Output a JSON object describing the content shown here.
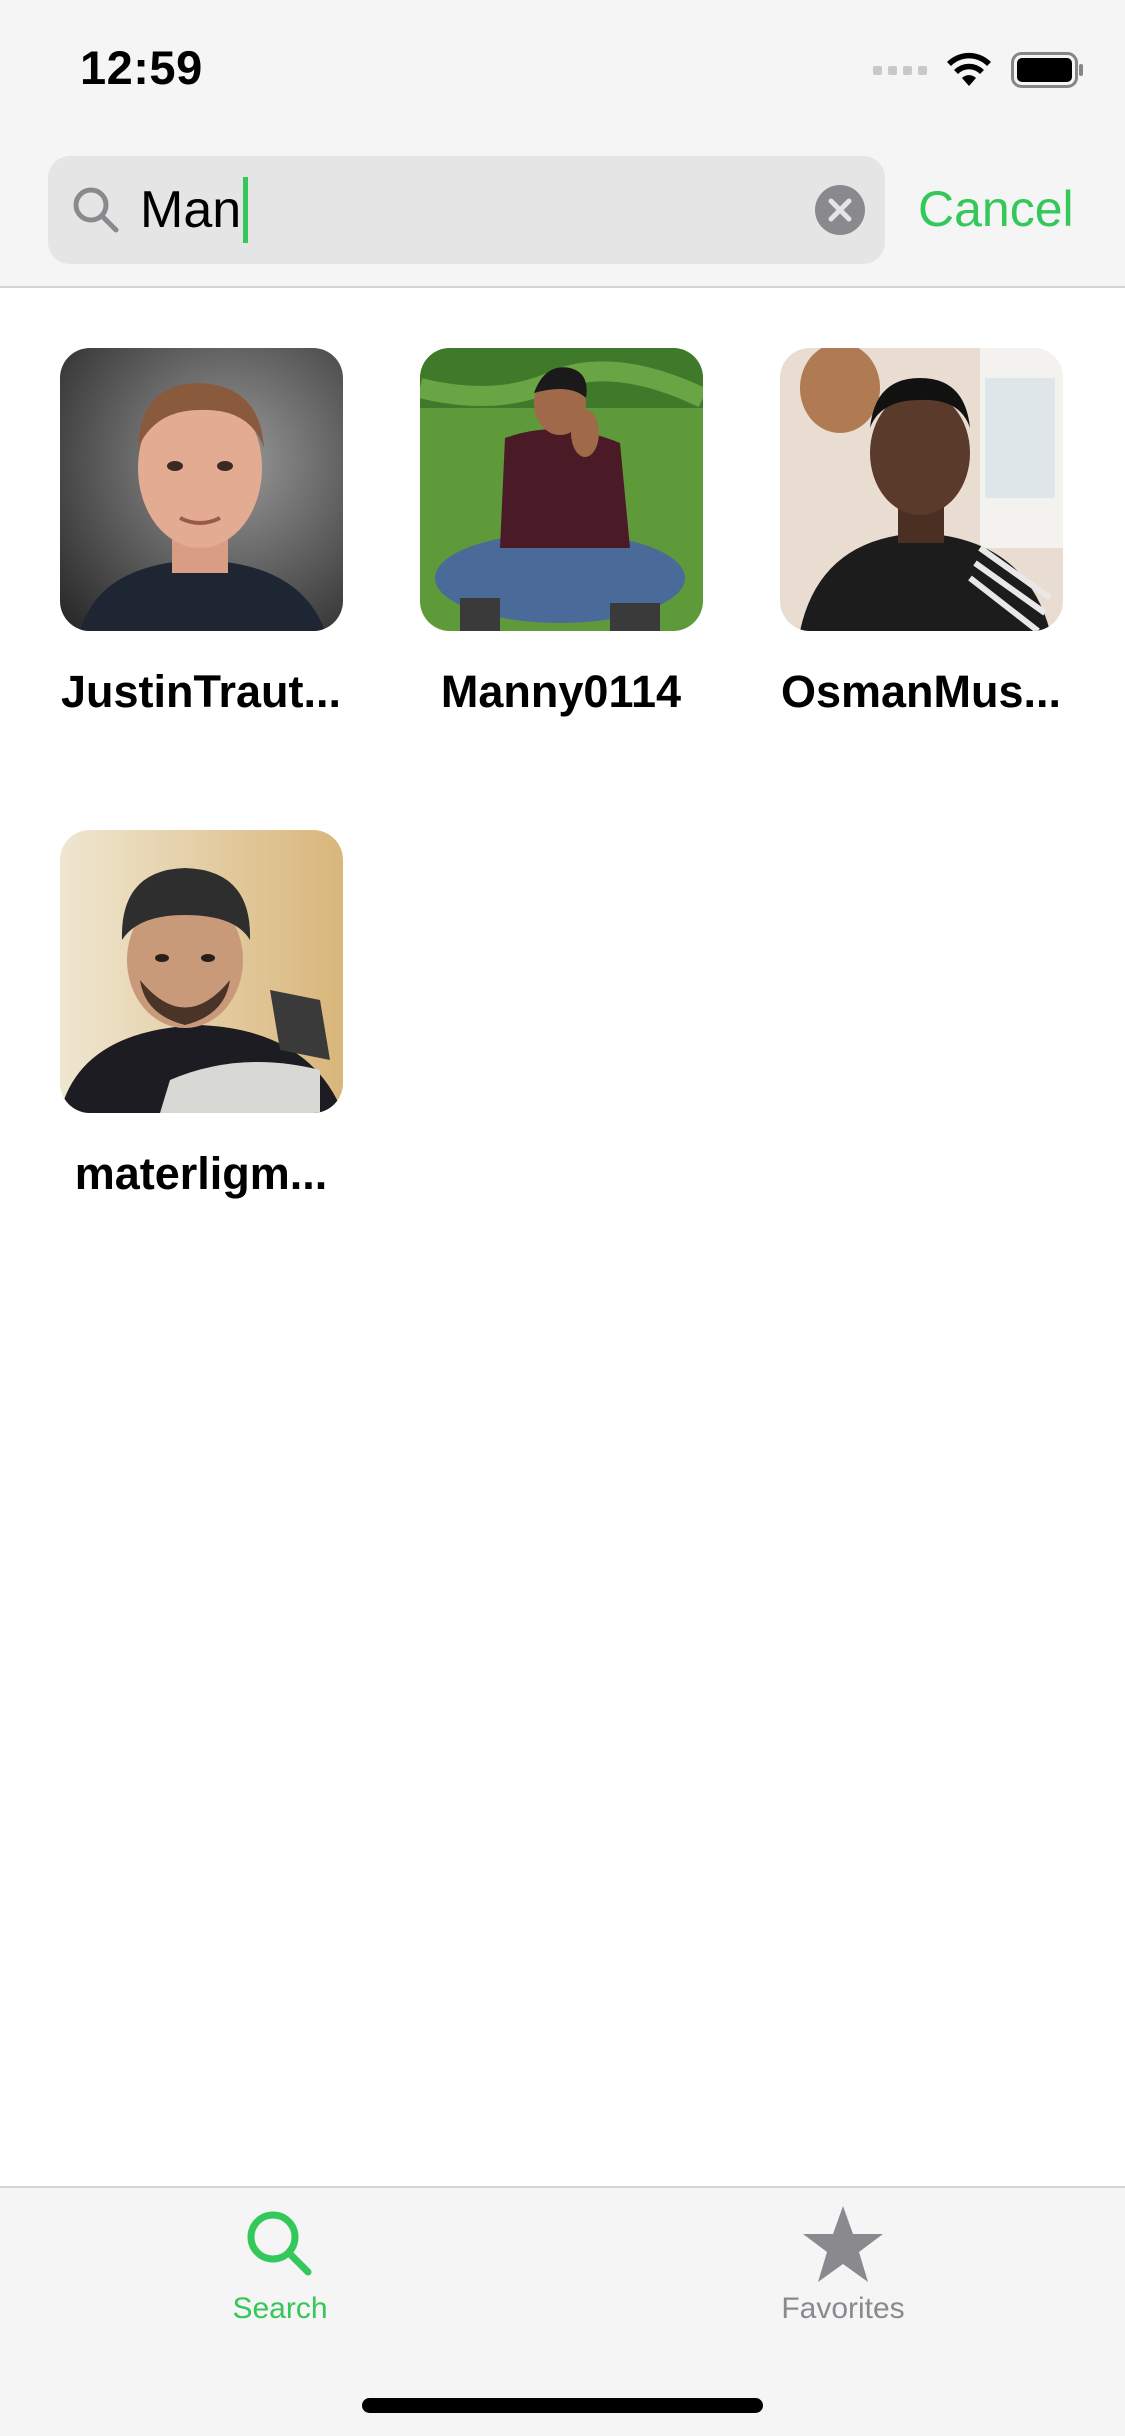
{
  "status_bar": {
    "time": "12:59"
  },
  "search": {
    "query": "Man",
    "cancel_label": "Cancel",
    "accent_color": "#34c759"
  },
  "results": [
    {
      "username": "JustinTraut..."
    },
    {
      "username": "Manny0114"
    },
    {
      "username": "OsmanMus..."
    },
    {
      "username": "materligm..."
    }
  ],
  "tab_bar": {
    "tabs": [
      {
        "label": "Search",
        "icon": "search-icon",
        "active": true
      },
      {
        "label": "Favorites",
        "icon": "star-icon",
        "active": false
      }
    ]
  }
}
